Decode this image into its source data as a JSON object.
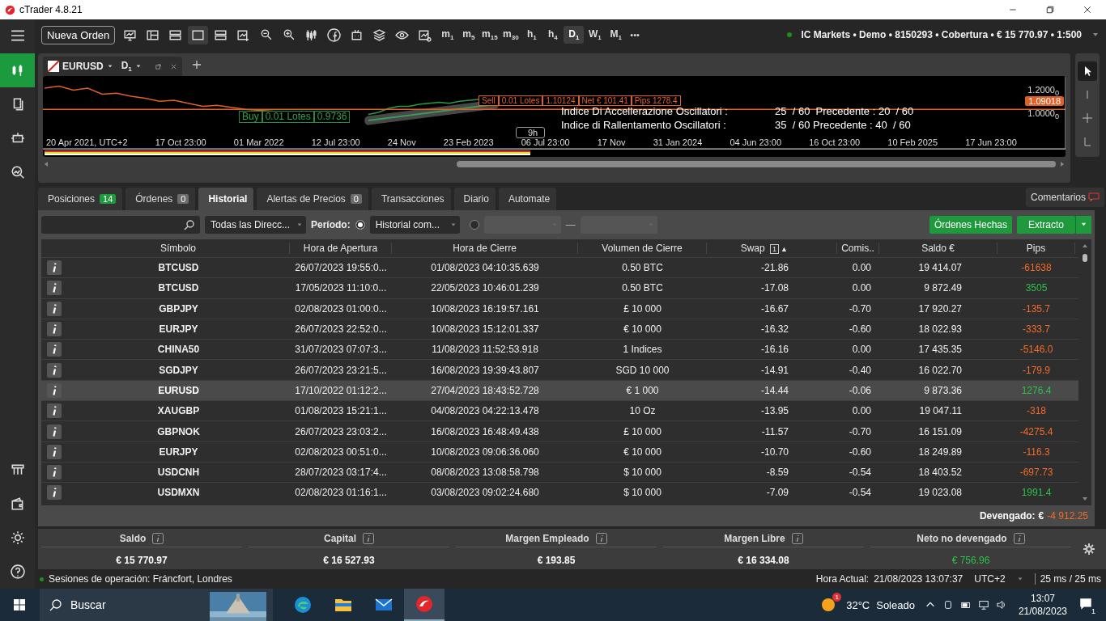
{
  "window": {
    "title": "cTrader 4.8.21"
  },
  "sidebar": [
    {
      "selected": true
    },
    {
      "selected": false
    },
    {
      "selected": false
    },
    {
      "selected": false
    }
  ],
  "toolbar": {
    "new_order": "Nueva Orden",
    "more": "•••",
    "timeframes": [
      {
        "label": "m$_{1}$",
        "selected": false
      },
      {
        "label": "m$_{5}$",
        "selected": false
      },
      {
        "label": "m$_{15}$",
        "selected": false
      },
      {
        "label": "m$_{30}$",
        "selected": false
      },
      {
        "label": "h$_{1}$",
        "selected": false
      },
      {
        "label": "h$_{4}$",
        "selected": false
      },
      {
        "label": "D$_{1}$",
        "selected": true
      },
      {
        "label": "W$_{1}$",
        "selected": false
      },
      {
        "label": "M$_{1}$",
        "selected": false
      }
    ]
  },
  "account": {
    "connected": true,
    "text": "IC Markets • Demo • 8150293 • Cobertura • € 15 770.97 • 1:500"
  },
  "chart": {
    "symbol": "EURUSD",
    "timeframe": "D$_{1}$",
    "buy": [
      "Buy",
      "0.01 Lotes",
      "0.9736"
    ],
    "sell": [
      "Sell",
      "0.01 Lotes",
      "1.10124",
      "Net € 101.41",
      "Pips 1278.4"
    ],
    "price": "1.09018",
    "yticks": [
      "1.2000$_{0}$",
      "1.0000$_{0}$"
    ],
    "bar_label": "9h",
    "indicators": [
      [
        "Indice Di Accellerazione Oscillatori :",
        "25  / 60  Precedente : 20  / 60"
      ],
      [
        "Indice di Rallentamento  Oscillatori :",
        "35  / 60 Precedente : 40  / 60"
      ]
    ],
    "xlabels": [
      "20 Apr 2021, UTC+2",
      "17 Oct 23:00",
      "01 Mar 2022",
      "12 Jul 23:00",
      "24 Nov",
      "23 Feb 2023",
      "06 Jul 23:00",
      "17 Nov",
      "31 Jan 2024",
      "04 Jun 23:00",
      "16 Oct 23:00",
      "10 Feb 2025",
      "17 Jun 23:00"
    ]
  },
  "tabs": [
    {
      "label": "Posiciones",
      "count": "14",
      "color": "#1e9a3c",
      "selected": false
    },
    {
      "label": "Órdenes",
      "count": "0",
      "color": "#6b6b6b",
      "selected": false
    },
    {
      "label": "Historial",
      "selected": true
    },
    {
      "label": "Alertas de Precios",
      "count": "0",
      "color": "#6b6b6b",
      "selected": false
    },
    {
      "label": "Transacciones",
      "selected": false
    },
    {
      "label": "Diario",
      "selected": false
    },
    {
      "label": "Automate",
      "selected": false
    }
  ],
  "comments": "Comentarios",
  "filters": {
    "direction": "Todas las Direcc...",
    "period_label": "Período:",
    "period": "Historial com...",
    "radios": [
      {
        "selected": true
      },
      {
        "selected": false
      }
    ],
    "dash": "—",
    "done_orders": "Órdenes Hechas",
    "statement": "Extracto"
  },
  "table": {
    "columns": [
      "Símbolo",
      "Hora de Apertura",
      "Hora de Cierre",
      "Volumen de Cierre",
      "Swap",
      "Comis..",
      "Saldo €",
      "Pips"
    ],
    "sort_badge": "1",
    "sort_arrow": "▲",
    "rows": [
      {
        "cells": [
          "BTCUSD",
          "26/07/2023 19:55:0...",
          "01/08/2023 04:10:35.639",
          "0.50 BTC",
          "-21.86",
          "0.00",
          "19 414.07",
          "-61638"
        ],
        "profit": false,
        "selected": false
      },
      {
        "cells": [
          "BTCUSD",
          "17/05/2023 11:10:0...",
          "22/05/2023 10:46:01.239",
          "0.50 BTC",
          "-17.08",
          "0.00",
          "9 872.49",
          "3505"
        ],
        "profit": true,
        "selected": false
      },
      {
        "cells": [
          "GBPJPY",
          "02/08/2023 01:00:0...",
          "10/08/2023 16:19:57.161",
          "£ 10 000",
          "-16.67",
          "-0.70",
          "17 920.27",
          "-135.7"
        ],
        "profit": false,
        "selected": false
      },
      {
        "cells": [
          "EURJPY",
          "26/07/2023 22:52:0...",
          "10/08/2023 15:12:01.337",
          "€ 10 000",
          "-16.32",
          "-0.60",
          "18 022.93",
          "-333.7"
        ],
        "profit": false,
        "selected": false
      },
      {
        "cells": [
          "CHINA50",
          "31/07/2023 07:07:3...",
          "11/08/2023 11:52:53.918",
          "1 Indices",
          "-16.16",
          "0.00",
          "17 435.35",
          "-5146.0"
        ],
        "profit": false,
        "selected": false
      },
      {
        "cells": [
          "SGDJPY",
          "26/07/2023 23:21:5...",
          "16/08/2023 19:39:43.807",
          "SGD 10 000",
          "-14.91",
          "-0.40",
          "16 022.70",
          "-179.9"
        ],
        "profit": false,
        "selected": false
      },
      {
        "cells": [
          "EURUSD",
          "17/10/2022 01:12:2...",
          "27/04/2023 18:43:52.728",
          "€ 1 000",
          "-14.44",
          "-0.06",
          "9 873.36",
          "1276.4"
        ],
        "profit": true,
        "selected": true
      },
      {
        "cells": [
          "XAUGBP",
          "01/08/2023 15:21:1...",
          "04/08/2023 04:22:13.478",
          "10 Oz",
          "-13.95",
          "0.00",
          "19 047.11",
          "-318"
        ],
        "profit": false,
        "selected": false
      },
      {
        "cells": [
          "GBPNOK",
          "26/07/2023 23:03:2...",
          "16/08/2023 16:48:49.438",
          "£ 10 000",
          "-11.57",
          "-0.70",
          "16 151.09",
          "-4275.4"
        ],
        "profit": false,
        "selected": false
      },
      {
        "cells": [
          "EURJPY",
          "02/08/2023 00:51:0...",
          "10/08/2023 09:06:36.060",
          "€ 10 000",
          "-10.70",
          "-0.60",
          "18 249.89",
          "-116.3"
        ],
        "profit": false,
        "selected": false
      },
      {
        "cells": [
          "USDCNH",
          "28/07/2023 03:17:4...",
          "08/08/2023 13:08:58.798",
          "$ 10 000",
          "-8.59",
          "-0.54",
          "18 403.52",
          "-697.73"
        ],
        "profit": false,
        "selected": false
      },
      {
        "cells": [
          "USDMXN",
          "02/08/2023 01:16:1...",
          "03/08/2023 09:02:24.680",
          "$ 10 000",
          "-7.09",
          "-0.54",
          "19 023.08",
          "1991.4"
        ],
        "profit": true,
        "selected": false
      }
    ]
  },
  "accrued": {
    "label": "Devengado:",
    "currency": "€",
    "value": "-4 912.25"
  },
  "summary": [
    {
      "label": "Saldo",
      "value": "€ 15 770.97",
      "profit": false
    },
    {
      "label": "Capital",
      "value": "€ 16 527.93",
      "profit": false
    },
    {
      "label": "Margen Empleado",
      "value": "€ 193.85",
      "profit": false
    },
    {
      "label": "Margen Libre",
      "value": "€ 16 334.08",
      "profit": false
    },
    {
      "label": "Neto no devengado",
      "value": "€ 756.96",
      "profit": true
    }
  ],
  "status": {
    "sessions": "Sesiones de operación: Fráncfort, Londres",
    "time_label": "Hora Actual:",
    "time": "21/08/2023 13:07:37",
    "tz": "UTC+2",
    "latency": "25 ms / 25 ms"
  },
  "taskbar": {
    "search": "Buscar",
    "weather_badge": "1",
    "temp": "32°C",
    "weather": "Soleado",
    "time": "13:07",
    "date": "21/08/2023",
    "notifications": "1"
  }
}
